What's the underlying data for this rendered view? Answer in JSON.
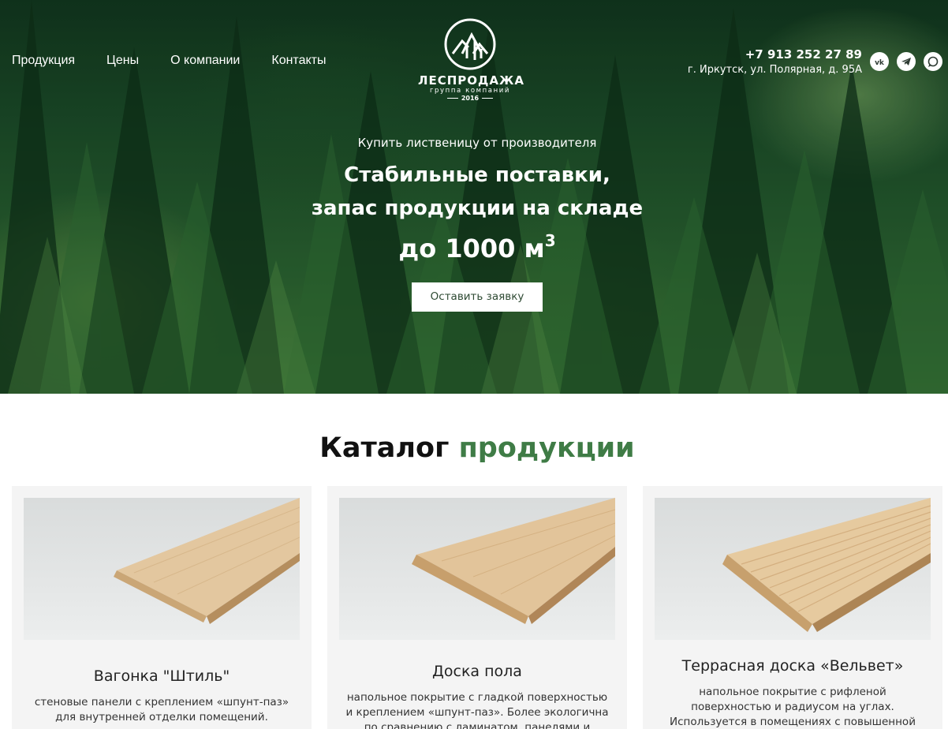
{
  "nav": {
    "items": [
      {
        "label": "Продукция"
      },
      {
        "label": "Цены"
      },
      {
        "label": "О компании"
      },
      {
        "label": "Контакты"
      }
    ]
  },
  "logo": {
    "name": "ЛЕСПРОДАЖА",
    "subtitle": "группа компаний",
    "year": "2016"
  },
  "contacts": {
    "phone": "+7 913 252 27 89",
    "address": "г. Иркутск, ул. Полярная, д. 95А",
    "socials": [
      {
        "icon": "vk-icon"
      },
      {
        "icon": "telegram-icon"
      },
      {
        "icon": "whatsapp-icon"
      }
    ]
  },
  "hero": {
    "pretitle": "Купить лиственицу от производителя",
    "title_line1": "Стабильные поставки,",
    "title_line2": "запас продукции на складе",
    "volume": "до 1000 м",
    "volume_sup": "3",
    "cta_label": "Оставить заявку"
  },
  "catalog": {
    "title_main": "Каталог",
    "title_accent": "продукции",
    "accent_color": "#3f7c46",
    "cards": [
      {
        "title": "Вагонка \"Штиль\"",
        "desc_line1": "стеновые панели с креплением «шпунт-паз»",
        "desc_line2": "для внутренней отделки помещений."
      },
      {
        "title": "Доска пола",
        "desc_line1": "напольное покрытие с гладкой поверхностью",
        "desc_line2": "и креплением «шпунт-паз». Более экологична",
        "desc_line3": "по сравнению с ламинатом, панелями и"
      },
      {
        "title": "Террасная доска «Вельвет»",
        "desc_line1": "напольное покрытие с рифленой",
        "desc_line2": "поверхностью и радиусом на углах.",
        "desc_line3": "Используется в помещениях с повышенной"
      }
    ]
  }
}
